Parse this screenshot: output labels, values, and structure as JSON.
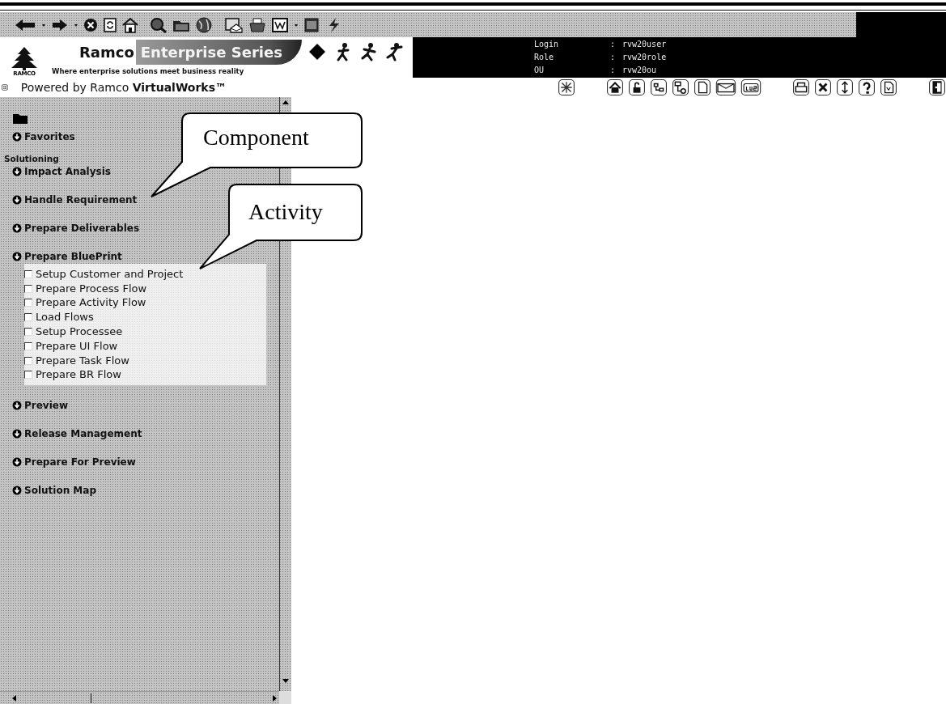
{
  "header": {
    "logo_text": "RAMCO",
    "brand": "Ramco",
    "product": "Enterprise Series",
    "tagline": "Where enterprise solutions meet business reality"
  },
  "session": [
    {
      "label": "Login",
      "separator": ":",
      "value": "rvw20user"
    },
    {
      "label": "Role",
      "separator": ":",
      "value": "rvw20role"
    },
    {
      "label": "OU",
      "separator": ":",
      "value": "rvw20ou"
    }
  ],
  "powered_by": "Powered by Ramco **VirtualWorks™**",
  "sidebar": {
    "items": [
      {
        "kind": "link",
        "label": "Favorites"
      },
      {
        "kind": "heading",
        "label": "Solutioning"
      },
      {
        "kind": "group",
        "label": "Impact Analysis"
      },
      {
        "kind": "group",
        "label": "Handle Requirement"
      },
      {
        "kind": "group",
        "label": "Prepare Deliverables"
      },
      {
        "kind": "group",
        "label": "Prepare BluePrint",
        "children": [
          {
            "label": "Setup Customer and Project",
            "checked": false
          },
          {
            "label": "Prepare Process Flow",
            "checked": false
          },
          {
            "label": "Prepare Activity Flow",
            "checked": false
          },
          {
            "label": "Load Flows",
            "checked": false
          },
          {
            "label": "Setup Processee",
            "checked": false
          },
          {
            "label": "Prepare UI Flow",
            "checked": false
          },
          {
            "label": "Prepare Task Flow",
            "checked": false
          },
          {
            "label": "Prepare BR Flow",
            "checked": false
          }
        ]
      },
      {
        "kind": "group",
        "label": "Preview"
      },
      {
        "kind": "group",
        "label": "Release Management"
      },
      {
        "kind": "group",
        "label": "Prepare For Preview"
      },
      {
        "kind": "group",
        "label": "Solution Map"
      }
    ]
  },
  "callouts": [
    {
      "text": "Component"
    },
    {
      "text": "Activity"
    }
  ]
}
